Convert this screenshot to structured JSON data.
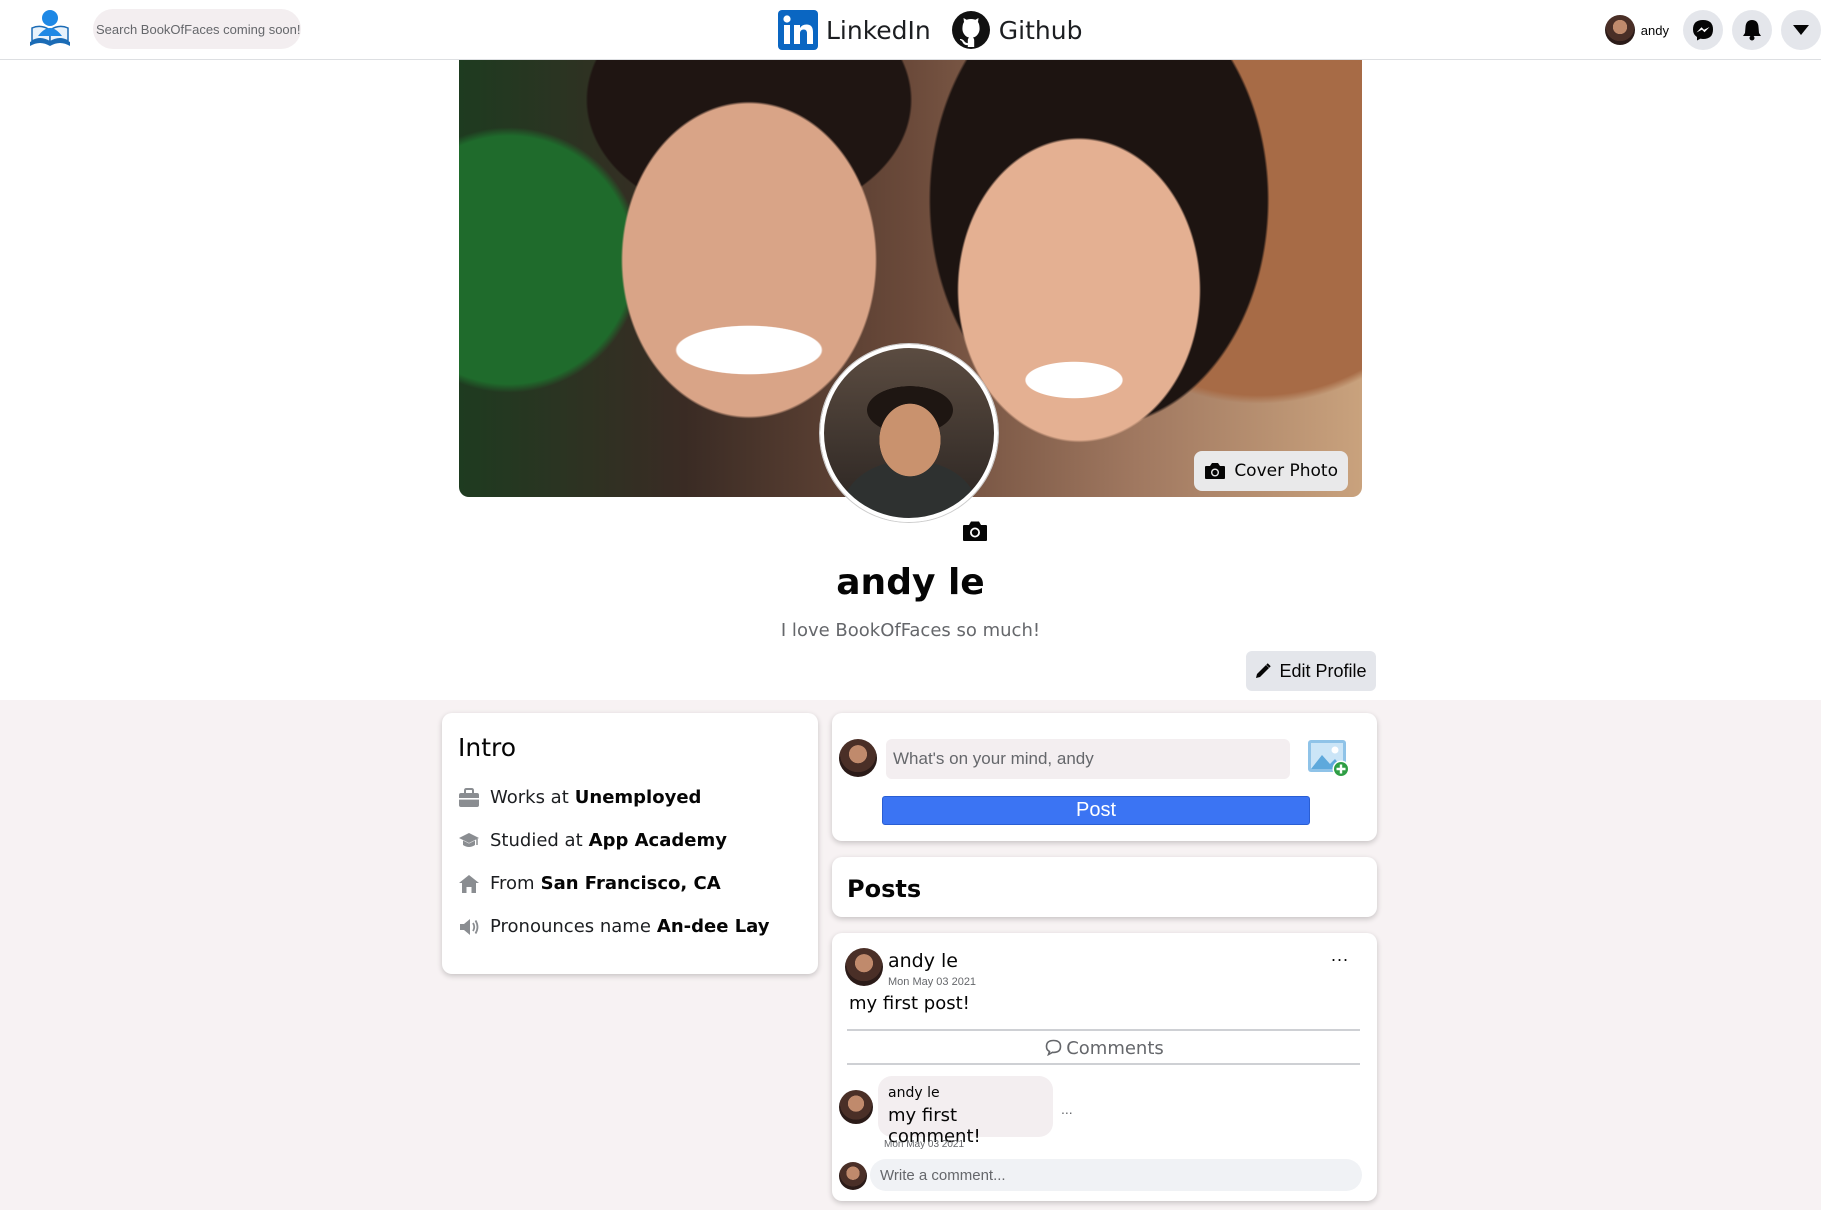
{
  "navbar": {
    "logo": "book-logo-icon",
    "search_placeholder": "Search BookOfFaces coming soon!",
    "links": [
      {
        "label": "LinkedIn",
        "icon": "linkedin-icon",
        "color": "#0a66c2"
      },
      {
        "label": "Github",
        "icon": "github-icon",
        "color": "#000000"
      }
    ],
    "user": {
      "name": "andy"
    },
    "icons": [
      "messenger-icon",
      "bell-icon",
      "caret-down-icon"
    ]
  },
  "profile": {
    "name": "andy le",
    "bio": "I love BookOfFaces so much!",
    "cover_button_label": "Cover Photo",
    "edit_button_label": "Edit Profile"
  },
  "intro": {
    "title": "Intro",
    "rows": [
      {
        "icon": "briefcase-icon",
        "label": "Works at",
        "value": "Unemployed"
      },
      {
        "icon": "graduation-cap-icon",
        "label": "Studied at",
        "value": "App Academy"
      },
      {
        "icon": "house-icon",
        "label": "From",
        "value": "San Francisco, CA"
      },
      {
        "icon": "speaker-icon",
        "label": "Pronounces name",
        "value": "An-dee Lay"
      }
    ]
  },
  "composer": {
    "placeholder": "What's on your mind, andy",
    "post_button_label": "Post"
  },
  "posts": {
    "title": "Posts",
    "items": [
      {
        "author": "andy le",
        "date": "Mon May 03 2021",
        "more": "...",
        "body": "my first post!",
        "comments_label": "Comments",
        "comments": [
          {
            "author": "andy le",
            "text": "my first comment!",
            "date": "Mon May 03 2021",
            "more": "..."
          }
        ],
        "write_placeholder": "Write a comment..."
      }
    ]
  },
  "colors": {
    "accent": "#3b74f3",
    "page_bg": "#f7f2f3",
    "linkedin": "#0a66c2"
  }
}
